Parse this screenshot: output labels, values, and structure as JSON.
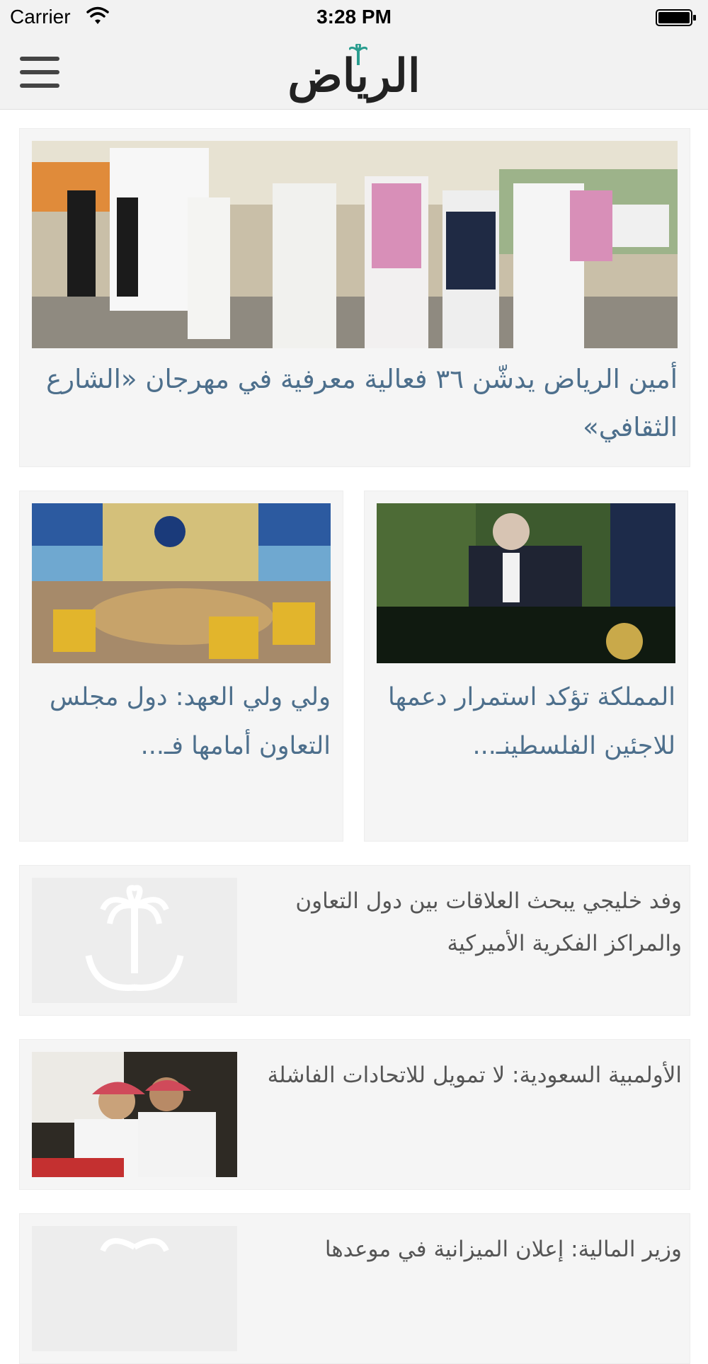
{
  "status_bar": {
    "carrier": "Carrier",
    "time": "3:28 PM"
  },
  "nav": {
    "logo_text": "الرياض",
    "menu_icon": "hamburger-menu-icon"
  },
  "colors": {
    "title_blue": "#4d6f8c",
    "title_gray": "#555555",
    "card_bg": "#f5f5f5",
    "bar_bg": "#f2f2f2"
  },
  "articles": {
    "hero": {
      "title": "أمين الرياض يدشّن ٣٦ فعالية معرفية في مهرجان «الشارع الثقافي»",
      "image": "photo-officials-walking-festival"
    },
    "grid": [
      {
        "title": "المملكة تؤكد استمرار دعمها للاجئين الفلسطينـ...",
        "image": "photo-speaker-un-podium"
      },
      {
        "title": "ولي ولي العهد: دول مجلس التعاون أمامها فـ...",
        "image": "photo-gcc-council-meeting"
      }
    ],
    "list": [
      {
        "title": "وفد خليجي يبحث العلاقات بين دول التعاون والمراكز الفكرية الأميركية",
        "image": "placeholder-logo"
      },
      {
        "title": "الأولمبية السعودية: لا تمويل للاتحادات الفاشلة",
        "image": "photo-officials-at-table"
      },
      {
        "title": "وزير المالية: إعلان الميزانية في موعدها",
        "image": "placeholder-logo"
      }
    ]
  }
}
